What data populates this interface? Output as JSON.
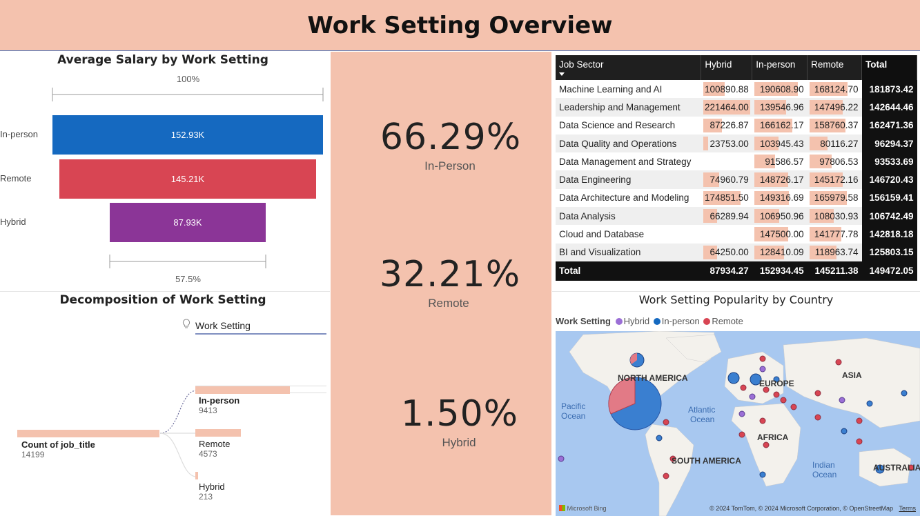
{
  "header": {
    "title": "Work Setting Overview"
  },
  "funnel": {
    "title": "Average Salary by Work Setting",
    "top_pct": "100%",
    "bottom_pct": "57.5%",
    "bars": [
      {
        "label": "In-person",
        "value_label": "152.93K",
        "value": 152.93,
        "color": "#1569c0"
      },
      {
        "label": "Remote",
        "value_label": "145.21K",
        "value": 145.21,
        "color": "#d84553"
      },
      {
        "label": "Hybrid",
        "value_label": "87.93K",
        "value": 87.93,
        "color": "#8b3597"
      }
    ]
  },
  "decomp": {
    "title": "Decomposition of Work Setting",
    "level_label": "Work Setting",
    "root": {
      "label": "Count of job_title",
      "value": "14199"
    },
    "children": [
      {
        "label": "In-person",
        "value": "9413",
        "count": 9413
      },
      {
        "label": "Remote",
        "value": "4573",
        "count": 4573
      },
      {
        "label": "Hybrid",
        "value": "213",
        "count": 213
      }
    ]
  },
  "kpis": [
    {
      "value": "66.29%",
      "label": "In-Person"
    },
    {
      "value": "32.21%",
      "label": "Remote"
    },
    {
      "value": "1.50%",
      "label": "Hybrid"
    }
  ],
  "matrix": {
    "headers": [
      "Job Sector",
      "Hybrid",
      "In-person",
      "Remote",
      "Total"
    ],
    "rows": [
      {
        "sector": "Machine Learning and AI",
        "hybrid": "100890.88",
        "inperson": "190608.90",
        "remote": "168124.70",
        "total": "181873.42",
        "h": 100890.88,
        "i": 190608.9,
        "r": 168124.7
      },
      {
        "sector": "Leadership and Management",
        "hybrid": "221464.00",
        "inperson": "139546.96",
        "remote": "147496.22",
        "total": "142644.46",
        "h": 221464.0,
        "i": 139546.96,
        "r": 147496.22
      },
      {
        "sector": "Data Science and Research",
        "hybrid": "87226.87",
        "inperson": "166162.17",
        "remote": "158760.37",
        "total": "162471.36",
        "h": 87226.87,
        "i": 166162.17,
        "r": 158760.37
      },
      {
        "sector": "Data Quality and Operations",
        "hybrid": "23753.00",
        "inperson": "103945.43",
        "remote": "80116.27",
        "total": "96294.37",
        "h": 23753.0,
        "i": 103945.43,
        "r": 80116.27
      },
      {
        "sector": "Data Management and Strategy",
        "hybrid": "",
        "inperson": "91586.57",
        "remote": "97806.53",
        "total": "93533.69",
        "h": 0,
        "i": 91586.57,
        "r": 97806.53
      },
      {
        "sector": "Data Engineering",
        "hybrid": "74960.79",
        "inperson": "148726.17",
        "remote": "145172.16",
        "total": "146720.43",
        "h": 74960.79,
        "i": 148726.17,
        "r": 145172.16
      },
      {
        "sector": "Data Architecture and Modeling",
        "hybrid": "174851.50",
        "inperson": "149316.69",
        "remote": "165979.58",
        "total": "156159.41",
        "h": 174851.5,
        "i": 149316.69,
        "r": 165979.58
      },
      {
        "sector": "Data Analysis",
        "hybrid": "66289.94",
        "inperson": "106950.96",
        "remote": "108030.93",
        "total": "106742.49",
        "h": 66289.94,
        "i": 106950.96,
        "r": 108030.93
      },
      {
        "sector": "Cloud and Database",
        "hybrid": "",
        "inperson": "147500.00",
        "remote": "141777.78",
        "total": "142818.18",
        "h": 0,
        "i": 147500.0,
        "r": 141777.78
      },
      {
        "sector": "BI and Visualization",
        "hybrid": "64250.00",
        "inperson": "128410.09",
        "remote": "118963.74",
        "total": "125803.15",
        "h": 64250.0,
        "i": 128410.09,
        "r": 118963.74
      }
    ],
    "total_row": {
      "label": "Total",
      "hybrid": "87934.27",
      "inperson": "152934.45",
      "remote": "145211.38",
      "total": "149472.05"
    }
  },
  "map": {
    "title": "Work Setting Popularity by Country",
    "legend_title": "Work Setting",
    "legend": [
      {
        "name": "Hybrid",
        "color": "#9b6fd6"
      },
      {
        "name": "In-person",
        "color": "#1569c0"
      },
      {
        "name": "Remote",
        "color": "#d84553"
      }
    ],
    "labels": {
      "north_america": "NORTH AMERICA",
      "europe": "EUROPE",
      "asia": "ASIA",
      "africa": "AFRICA",
      "south_america": "SOUTH AMERICA",
      "australia": "AUSTRALIA",
      "pacific": "Pacific",
      "pacific2": "Ocean",
      "atlantic": "Atlantic",
      "atlantic2": "Ocean",
      "indian": "Indian",
      "indian2": "Ocean"
    },
    "attribution": "© 2024 TomTom, © 2024 Microsoft Corporation, © OpenStreetMap",
    "terms": "Terms",
    "bing": "Microsoft Bing"
  }
}
